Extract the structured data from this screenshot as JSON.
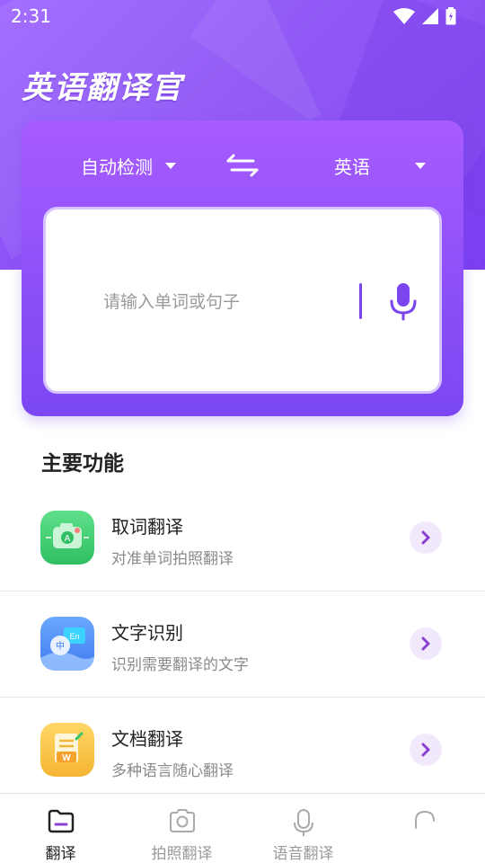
{
  "status_bar": {
    "time": "2:31",
    "icons": [
      "wifi-icon",
      "signal-icon",
      "battery-icon"
    ]
  },
  "app": {
    "title": "英语翻译官"
  },
  "translator": {
    "source_language": "自动检测",
    "target_language": "英语",
    "input_placeholder": "请输入单词或句子",
    "swap_icon": "swap-arrows-icon",
    "mic_icon": "microphone-icon"
  },
  "section": {
    "title": "主要功能"
  },
  "features": [
    {
      "title": "取词翻译",
      "subtitle": "对准单词拍照翻译",
      "icon": "camera-word-icon"
    },
    {
      "title": "文字识别",
      "subtitle": "识别需要翻译的文字",
      "icon": "chat-text-icon"
    },
    {
      "title": "文档翻译",
      "subtitle": "多种语言随心翻译",
      "icon": "document-icon"
    }
  ],
  "bottom_nav": [
    {
      "label": "翻译",
      "icon": "translate-icon",
      "active": true
    },
    {
      "label": "拍照翻译",
      "icon": "camera-icon",
      "active": false
    },
    {
      "label": "语音翻译",
      "icon": "microphone-icon",
      "active": false
    },
    {
      "label": "",
      "icon": "profile-icon",
      "active": false
    }
  ],
  "colors": {
    "brand_purple": "#8a4ff5",
    "accent_purple": "#7a45ef",
    "arrow_bg": "#f2e8fb"
  }
}
